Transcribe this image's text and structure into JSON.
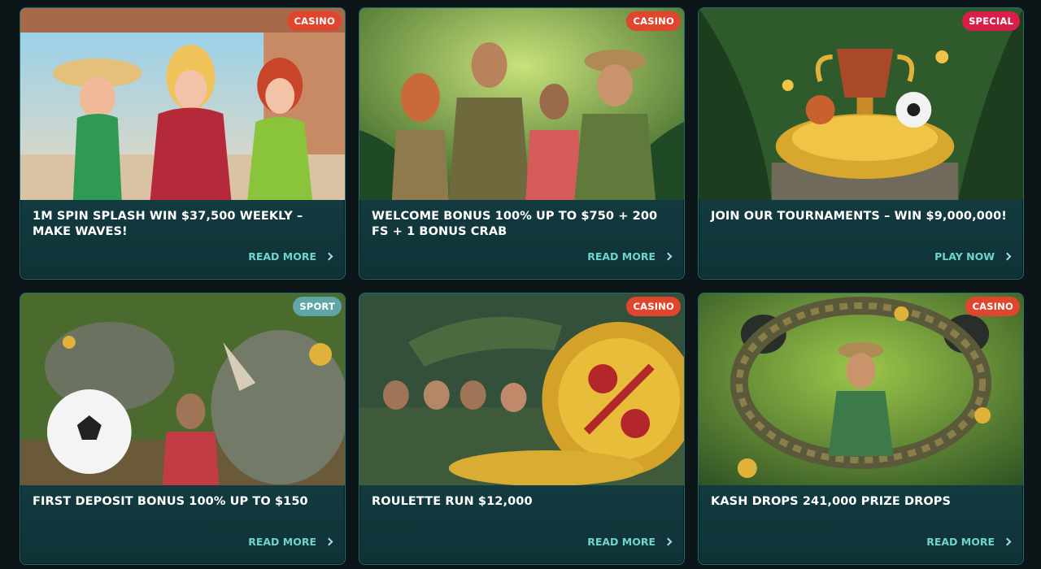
{
  "promotions": [
    {
      "badge": "CASINO",
      "title": "1M SPIN SPLASH WIN $37,500 WEEKLY – MAKE WAVES!",
      "cta": "READ MORE",
      "image_icon": "beach-women-image"
    },
    {
      "badge": "CASINO",
      "title": "WELCOME BONUS 100% UP TO $750 + 200 FS + 1 BONUS CRAB",
      "cta": "READ MORE",
      "image_icon": "jungle-explorers-image"
    },
    {
      "badge": "SPECIAL",
      "title": "JOIN OUR TOURNAMENTS – WIN $9,000,000!",
      "cta": "PLAY NOW",
      "image_icon": "trophy-coins-image"
    },
    {
      "badge": "SPORT",
      "title": "FIRST DEPOSIT BONUS 100% UP TO $150",
      "cta": "READ MORE",
      "image_icon": "rhino-soccer-image"
    },
    {
      "badge": "CASINO",
      "title": "ROULETTE RUN $12,000",
      "cta": "READ MORE",
      "image_icon": "crocodile-coin-image"
    },
    {
      "badge": "CASINO",
      "title": "KASH DROPS 241,000 PRIZE DROPS",
      "cta": "READ MORE",
      "image_icon": "snake-explorer-image"
    }
  ],
  "colors": {
    "casino_badge": "#e0452d",
    "special_badge": "#d81f4a",
    "sport_badge": "#5fa6a8",
    "cta": "#6fd3cf",
    "card_bg": "#1a4c50"
  }
}
